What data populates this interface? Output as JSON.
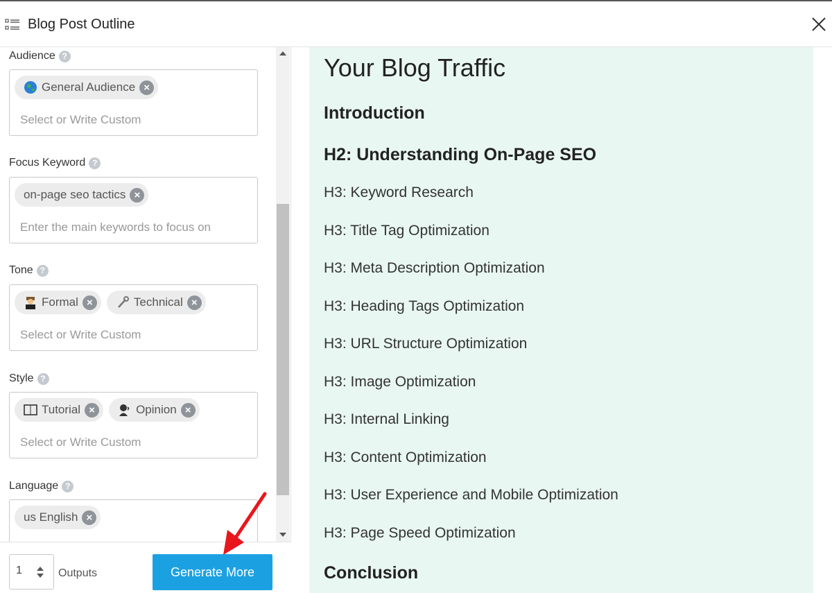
{
  "header": {
    "title": "Blog Post Outline",
    "list_icon": "list-icon",
    "close_icon": "close-icon"
  },
  "form": {
    "audience": {
      "label": "Audience",
      "chips": [
        {
          "icon": "globe-icon",
          "label": "General Audience"
        }
      ],
      "placeholder": "Select or Write Custom"
    },
    "focus_keyword": {
      "label": "Focus Keyword",
      "chips": [
        {
          "label": "on-page seo tactics"
        }
      ],
      "placeholder": "Enter the main keywords to focus on"
    },
    "tone": {
      "label": "Tone",
      "chips": [
        {
          "icon": "judge-icon",
          "label": "Formal"
        },
        {
          "icon": "wrench-icon",
          "label": "Technical"
        }
      ],
      "placeholder": "Select or Write Custom"
    },
    "style": {
      "label": "Style",
      "chips": [
        {
          "icon": "book-icon",
          "label": "Tutorial"
        },
        {
          "icon": "speaker-icon",
          "label": "Opinion"
        }
      ],
      "placeholder": "Select or Write Custom"
    },
    "language": {
      "label": "Language",
      "chips": [
        {
          "label": "us English"
        }
      ]
    }
  },
  "footer": {
    "outputs_value": "1",
    "outputs_label": "Outputs",
    "generate_label": "Generate More"
  },
  "outline": {
    "title": "Your Blog Traffic",
    "items": [
      {
        "level": "h2",
        "text": "Introduction"
      },
      {
        "level": "h2",
        "text": "H2: Understanding On-Page SEO"
      },
      {
        "level": "h3",
        "text": "H3: Keyword Research"
      },
      {
        "level": "h3",
        "text": "H3: Title Tag Optimization"
      },
      {
        "level": "h3",
        "text": "H3: Meta Description Optimization"
      },
      {
        "level": "h3",
        "text": "H3: Heading Tags Optimization"
      },
      {
        "level": "h3",
        "text": "H3: URL Structure Optimization"
      },
      {
        "level": "h3",
        "text": "H3: Image Optimization"
      },
      {
        "level": "h3",
        "text": "H3: Internal Linking"
      },
      {
        "level": "h3",
        "text": "H3: Content Optimization"
      },
      {
        "level": "h3",
        "text": "H3: User Experience and Mobile Optimization"
      },
      {
        "level": "h3",
        "text": "H3: Page Speed Optimization"
      },
      {
        "level": "h2",
        "text": "Conclusion"
      }
    ]
  },
  "colors": {
    "accent": "#1ba1e2",
    "outline_bg": "#e9f7f2",
    "arrow": "#e8161d"
  }
}
